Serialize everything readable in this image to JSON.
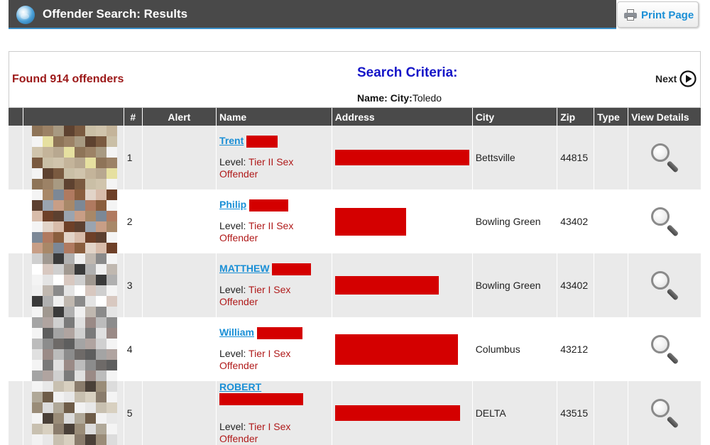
{
  "header": {
    "title": "Offender Search: Results",
    "print_label": "Print Page"
  },
  "summary": {
    "found": "Found 914 offenders",
    "criteria_title": "Search Criteria:",
    "criteria_name_label": "Name:",
    "criteria_city_label": "City:",
    "criteria_city_value": "Toledo",
    "next_label": "Next"
  },
  "table": {
    "columns": [
      "#",
      "Alert",
      "Name",
      "Address",
      "City",
      "Zip",
      "Type",
      "View Details"
    ],
    "level_label": "Level:",
    "rows": [
      {
        "num": "1",
        "first_name": "Trent",
        "level": "Tier II Sex Offender",
        "city": "Bettsville",
        "zip": "44815"
      },
      {
        "num": "2",
        "first_name": "Philip",
        "level": "Tier II Sex Offender",
        "city": "Bowling Green",
        "zip": "43402"
      },
      {
        "num": "3",
        "first_name": "MATTHEW",
        "level": "Tier I Sex Offender",
        "city": "Bowling Green",
        "zip": "43402"
      },
      {
        "num": "4",
        "first_name": "William",
        "level": "Tier I Sex Offender",
        "city": "Columbus",
        "zip": "43212"
      },
      {
        "num": "5",
        "first_name": "ROBERT",
        "level": "Tier I Sex Offender",
        "city": "DELTA",
        "zip": "43515"
      }
    ]
  },
  "colors": {
    "header_bg": "#494949",
    "link": "#1a8fd6",
    "found_text": "#9c1818",
    "criteria_title": "#1515c8",
    "redaction": "#d40000"
  },
  "icons": {
    "logo": "globe-icon",
    "print": "printer-icon",
    "next": "next-arrow-icon",
    "view": "magnifier-icon"
  }
}
